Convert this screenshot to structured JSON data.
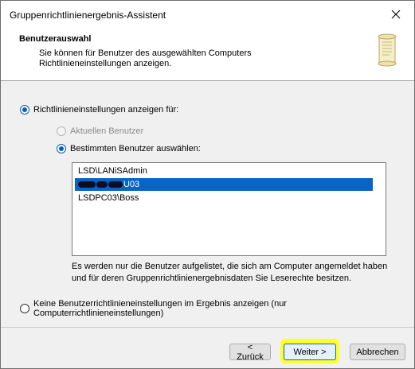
{
  "window": {
    "title": "Gruppenrichtlinienergebnis-Assistent",
    "close_symbol": "✕"
  },
  "header": {
    "title": "Benutzerauswahl",
    "description": "Sie können für Benutzer des ausgewählten Computers Richtlinieneinstellungen anzeigen.",
    "icon": "scroll-icon"
  },
  "options": {
    "show_policy_for": {
      "label": "Richtlinieneinstellungen anzeigen für:",
      "checked": true
    },
    "current_user": {
      "label": "Aktuellen Benutzer",
      "disabled": true
    },
    "specific_user": {
      "label": "Bestimmten Benutzer auswählen:",
      "checked": true
    },
    "no_user_settings": {
      "label": "Keine Benutzerrichtlinieneinstellungen im Ergebnis anzeigen (nur Computerrichtlinieneinstellungen)",
      "checked": false
    }
  },
  "users": {
    "items": [
      {
        "label": "LSD\\LANiSAdmin",
        "selected": false
      },
      {
        "label": "U03",
        "selected": true,
        "redacted_prefix": true
      },
      {
        "label": "LSDPC03\\Boss",
        "selected": false
      }
    ]
  },
  "note": "Es werden nur die Benutzer aufgelistet, die sich am Computer angemeldet haben und für deren Gruppenrichtlinienergebnisdaten Sie Leserechte besitzen.",
  "buttons": {
    "back": "< Zurück",
    "next": "Weiter >",
    "cancel": "Abbrechen"
  },
  "colors": {
    "selection": "#0a64c8",
    "highlight": "#ffff2a",
    "radio_checked": "#0a5fb5"
  }
}
